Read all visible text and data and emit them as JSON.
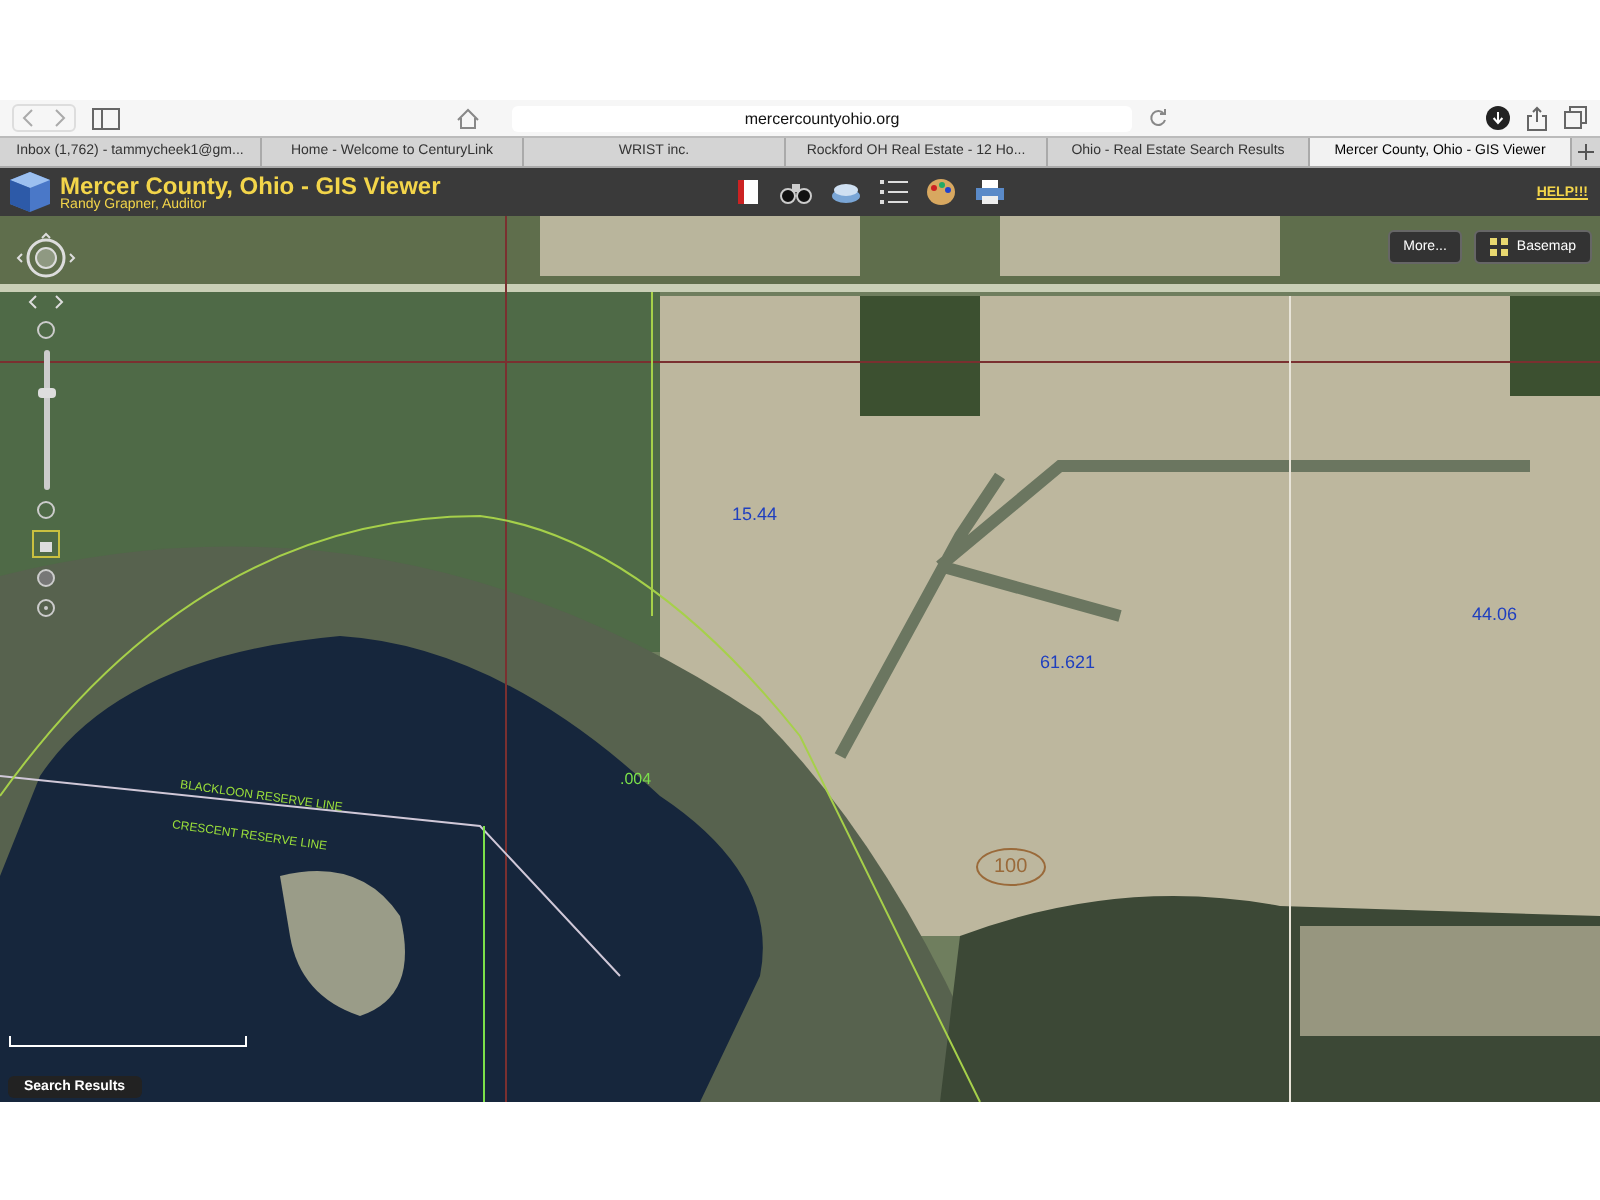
{
  "browser": {
    "url": "mercercountyohio.org"
  },
  "tabs": [
    {
      "label": "Inbox (1,762) - tammycheek1@gm...",
      "selected": false
    },
    {
      "label": "Home - Welcome to CenturyLink",
      "selected": false
    },
    {
      "label": "WRIST inc.",
      "selected": false
    },
    {
      "label": "Rockford OH Real Estate - 12 Ho...",
      "selected": false
    },
    {
      "label": "Ohio - Real Estate Search Results",
      "selected": false
    },
    {
      "label": "Mercer County, Ohio - GIS Viewer",
      "selected": true
    }
  ],
  "header": {
    "title": "Mercer County, Ohio - GIS Viewer",
    "subtitle": "Randy Grapner, Auditor",
    "help": "HELP!!!"
  },
  "map": {
    "buttons": [
      {
        "label": "More...",
        "kind": "plain"
      },
      {
        "label": "Basemap",
        "kind": "grid"
      }
    ],
    "zoom": {
      "level": 0.7
    },
    "labels": [
      {
        "text": "15.44",
        "kind": "acreage"
      },
      {
        "text": "61.621",
        "kind": "acreage"
      },
      {
        "text": "44.06",
        "kind": "acreage"
      },
      {
        "text": ".004",
        "kind": "annotation"
      },
      {
        "text": "BLACKLOON RESERVE LINE",
        "kind": "reserve"
      },
      {
        "text": "CRESCENT RESERVE LINE",
        "kind": "reserve"
      },
      {
        "text": "100",
        "kind": "flood"
      }
    ],
    "search_results": "Search Results"
  }
}
